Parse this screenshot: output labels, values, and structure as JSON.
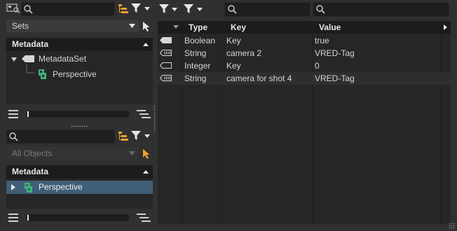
{
  "left_top": {
    "sets_label": "Sets",
    "tree_header": "Metadata",
    "tree": [
      {
        "label": "MetadataSet"
      },
      {
        "label": "Perspective"
      }
    ]
  },
  "left_bottom": {
    "filter_label": "All Objects",
    "tree_header": "Metadata",
    "tree": [
      {
        "label": "Perspective"
      }
    ]
  },
  "table": {
    "columns": [
      "Type",
      "Key",
      "Value"
    ],
    "rows": [
      {
        "type": "Boolean",
        "key": "Key",
        "value": "true"
      },
      {
        "type": "String",
        "key": "camera 2",
        "value": "VRED-Tag"
      },
      {
        "type": "Integer",
        "key": "Key",
        "value": "0"
      },
      {
        "type": "String",
        "key": "camera for shot 4",
        "value": "VRED-Tag"
      }
    ]
  },
  "colors": {
    "accent": "#f0a030",
    "selection": "#3f5e78",
    "node_green": "#3fb37a"
  }
}
